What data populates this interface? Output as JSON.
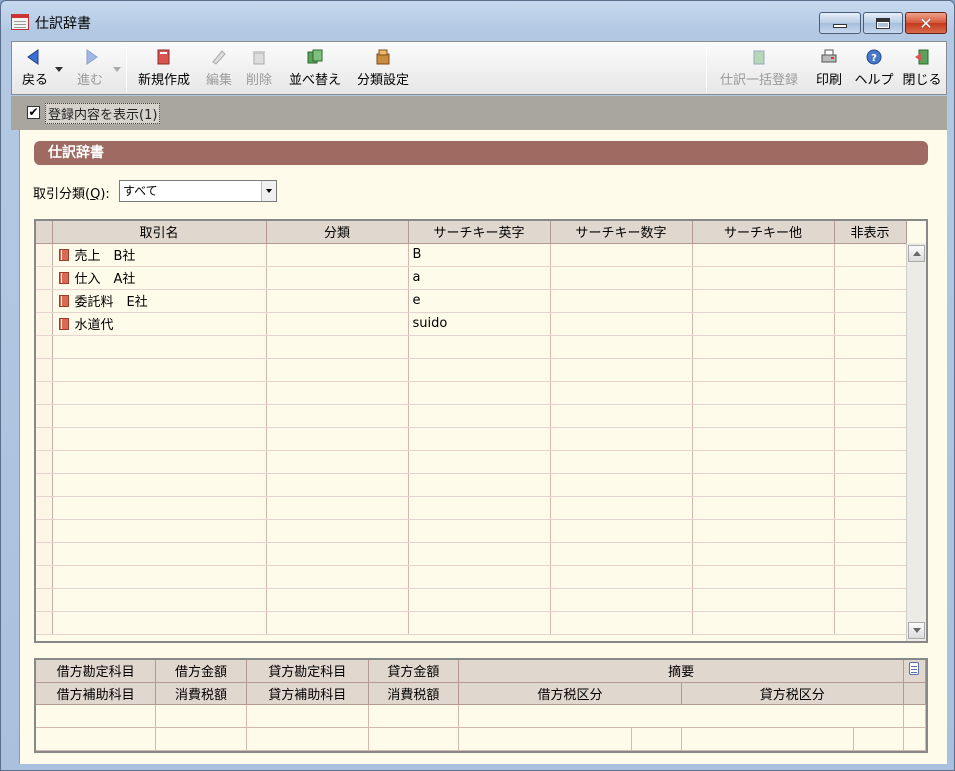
{
  "window": {
    "title": "仕訳辞書"
  },
  "toolbar": {
    "back": "戻る",
    "forward": "進む",
    "new": "新規作成",
    "edit": "編集",
    "delete": "削除",
    "sort": "並べ替え",
    "category_settings": "分類設定",
    "bulk_register": "仕訳一括登録",
    "print": "印刷",
    "help": "ヘルプ",
    "close": "閉じる"
  },
  "show_contents": {
    "label": "登録内容を表示(1)",
    "checked": true
  },
  "panel": {
    "title": "仕訳辞書"
  },
  "filter": {
    "label_prefix": "取引分類(",
    "label_key": "Q",
    "label_suffix": "):",
    "value": "すべて"
  },
  "grid": {
    "headers": [
      "取引名",
      "分類",
      "サーチキー英字",
      "サーチキー数字",
      "サーチキー他",
      "非表示"
    ],
    "rows": [
      {
        "name": "売上　B社",
        "category": "",
        "key_alpha": "B",
        "key_num": "",
        "key_other": "",
        "hidden": ""
      },
      {
        "name": "仕入　A社",
        "category": "",
        "key_alpha": "a",
        "key_num": "",
        "key_other": "",
        "hidden": ""
      },
      {
        "name": "委託料　E社",
        "category": "",
        "key_alpha": "e",
        "key_num": "",
        "key_other": "",
        "hidden": ""
      },
      {
        "name": "水道代",
        "category": "",
        "key_alpha": "suido",
        "key_num": "",
        "key_other": "",
        "hidden": ""
      }
    ]
  },
  "detail": {
    "row1": [
      "借方勘定科目",
      "借方金額",
      "貸方勘定科目",
      "貸方金額",
      "摘要"
    ],
    "row2": [
      "借方補助科目",
      "消費税額",
      "貸方補助科目",
      "消費税額",
      "借方税区分",
      "貸方税区分"
    ]
  }
}
